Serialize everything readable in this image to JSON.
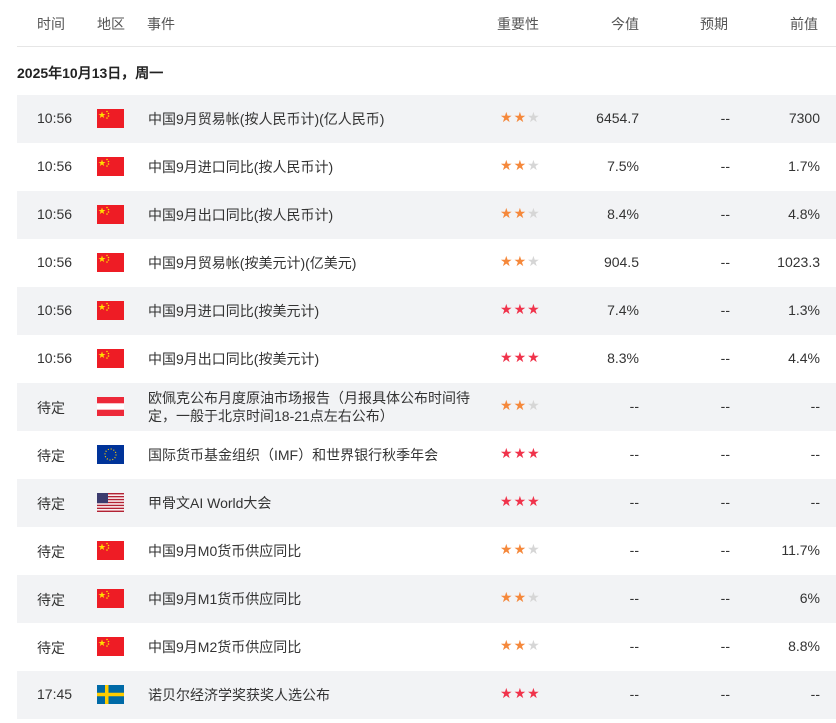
{
  "header": {
    "time": "时间",
    "region": "地区",
    "event": "事件",
    "importance": "重要性",
    "actual": "今值",
    "forecast": "预期",
    "previous": "前值"
  },
  "date_label": "2025年10月13日，周一",
  "colors": {
    "star_orange": "#f5883b",
    "star_red": "#f0334b",
    "star_gray": "#d6d6d6",
    "row_alt": "#f2f3f5"
  },
  "rows": [
    {
      "time": "10:56",
      "flag": "cn",
      "event": "中国9月贸易帐(按人民币计)(亿人民币)",
      "stars": 2,
      "actual": "6454.7",
      "forecast": "--",
      "previous": "7300"
    },
    {
      "time": "10:56",
      "flag": "cn",
      "event": "中国9月进口同比(按人民币计)",
      "stars": 2,
      "actual": "7.5%",
      "forecast": "--",
      "previous": "1.7%"
    },
    {
      "time": "10:56",
      "flag": "cn",
      "event": "中国9月出口同比(按人民币计)",
      "stars": 2,
      "actual": "8.4%",
      "forecast": "--",
      "previous": "4.8%"
    },
    {
      "time": "10:56",
      "flag": "cn",
      "event": "中国9月贸易帐(按美元计)(亿美元)",
      "stars": 2,
      "actual": "904.5",
      "forecast": "--",
      "previous": "1023.3"
    },
    {
      "time": "10:56",
      "flag": "cn",
      "event": "中国9月进口同比(按美元计)",
      "stars": 3,
      "actual": "7.4%",
      "forecast": "--",
      "previous": "1.3%"
    },
    {
      "time": "10:56",
      "flag": "cn",
      "event": "中国9月出口同比(按美元计)",
      "stars": 3,
      "actual": "8.3%",
      "forecast": "--",
      "previous": "4.4%"
    },
    {
      "time": "待定",
      "flag": "at",
      "event": "欧佩克公布月度原油市场报告（月报具体公布时间待定，一般于北京时间18-21点左右公布）",
      "stars": 2,
      "actual": "--",
      "forecast": "--",
      "previous": "--"
    },
    {
      "time": "待定",
      "flag": "eu",
      "event": "国际货币基金组织（IMF）和世界银行秋季年会",
      "stars": 3,
      "actual": "--",
      "forecast": "--",
      "previous": "--"
    },
    {
      "time": "待定",
      "flag": "us",
      "event": "甲骨文AI World大会",
      "stars": 3,
      "actual": "--",
      "forecast": "--",
      "previous": "--"
    },
    {
      "time": "待定",
      "flag": "cn",
      "event": "中国9月M0货币供应同比",
      "stars": 2,
      "actual": "--",
      "forecast": "--",
      "previous": "11.7%"
    },
    {
      "time": "待定",
      "flag": "cn",
      "event": "中国9月M1货币供应同比",
      "stars": 2,
      "actual": "--",
      "forecast": "--",
      "previous": "6%"
    },
    {
      "time": "待定",
      "flag": "cn",
      "event": "中国9月M2货币供应同比",
      "stars": 2,
      "actual": "--",
      "forecast": "--",
      "previous": "8.8%"
    },
    {
      "time": "17:45",
      "flag": "se",
      "event": "诺贝尔经济学奖获奖人选公布",
      "stars": 3,
      "actual": "--",
      "forecast": "--",
      "previous": "--"
    }
  ]
}
